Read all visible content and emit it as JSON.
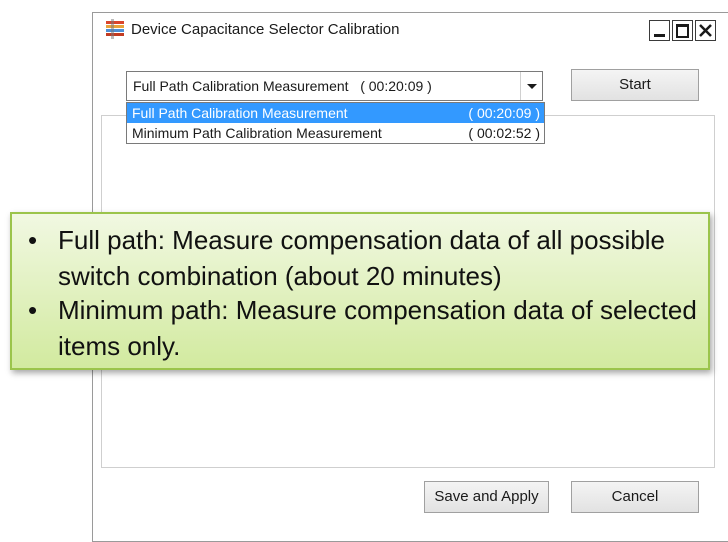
{
  "window": {
    "title": "Device Capacitance Selector Calibration",
    "icon": "device-app-icon"
  },
  "combo": {
    "selected_label": "Full Path Calibration Measurement",
    "selected_time": "( 00:20:09 )",
    "options": [
      {
        "label": "Full Path Calibration Measurement",
        "time": "( 00:20:09 )",
        "selected": true
      },
      {
        "label": "Minimum Path Calibration Measurement",
        "time": "( 00:02:52 )",
        "selected": false
      }
    ]
  },
  "buttons": {
    "start": "Start",
    "save_apply": "Save and Apply",
    "cancel": "Cancel"
  },
  "callout": {
    "items": [
      "Full path: Measure compensation data of all possible switch combination (about 20 minutes)",
      "Minimum path: Measure compensation data of selected items only."
    ],
    "bullet": "•"
  },
  "colors": {
    "selection": "#3399ff",
    "callout_border": "#9bc44b",
    "callout_fill_top": "#f1f8e2",
    "callout_fill_bottom": "#d2ea9f"
  }
}
